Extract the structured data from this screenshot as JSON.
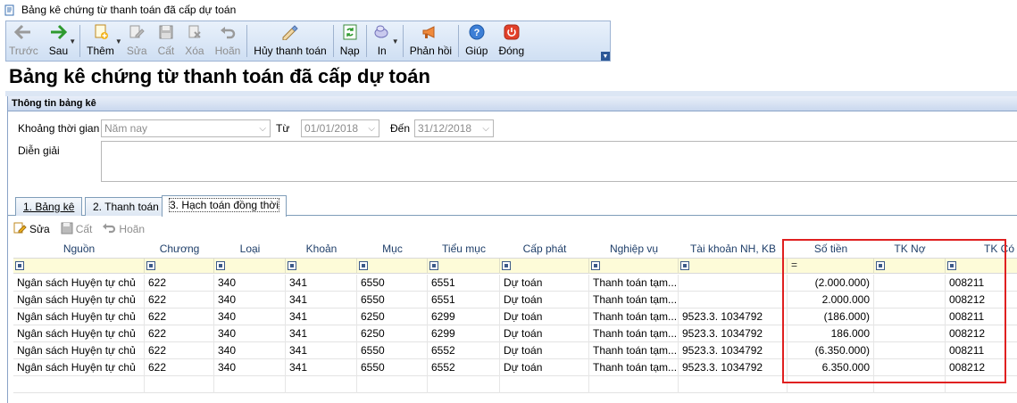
{
  "window": {
    "title": "Bảng kê chứng từ thanh toán đã cấp dự toán"
  },
  "toolbar": {
    "buttons": [
      {
        "label": "Trước",
        "icon": "arrow-left-icon",
        "enabled": false
      },
      {
        "label": "Sau",
        "icon": "arrow-right-icon",
        "enabled": true
      },
      {
        "label": "Thêm",
        "icon": "add-document-icon",
        "enabled": true
      },
      {
        "label": "Sửa",
        "icon": "edit-icon",
        "enabled": false
      },
      {
        "label": "Cất",
        "icon": "save-icon",
        "enabled": false
      },
      {
        "label": "Xóa",
        "icon": "delete-icon",
        "enabled": false
      },
      {
        "label": "Hoãn",
        "icon": "undo-icon",
        "enabled": false
      },
      {
        "label": "Hủy thanh toán",
        "icon": "cancel-payment-icon",
        "enabled": true
      },
      {
        "label": "Nạp",
        "icon": "refresh-icon",
        "enabled": true
      },
      {
        "label": "In",
        "icon": "print-icon",
        "enabled": true
      },
      {
        "label": "Phản hồi",
        "icon": "feedback-icon",
        "enabled": true
      },
      {
        "label": "Giúp",
        "icon": "help-icon",
        "enabled": true
      },
      {
        "label": "Đóng",
        "icon": "power-icon",
        "enabled": true
      }
    ]
  },
  "page": {
    "title": "Bảng kê chứng từ thanh toán đã cấp dự toán"
  },
  "info": {
    "header": "Thông tin bảng kê",
    "period_label": "Khoảng thời gian",
    "period_value": "Năm nay",
    "from_label": "Từ",
    "from_value": "01/01/2018",
    "to_label": "Đến",
    "to_value": "31/12/2018",
    "desc_label": "Diễn giải",
    "desc_value": ""
  },
  "tabs": [
    {
      "label": "1. Bảng kê"
    },
    {
      "label": "2. Thanh toán"
    },
    {
      "label": "3. Hạch toán đồng thời"
    }
  ],
  "subtoolbar": {
    "edit": "Sửa",
    "save": "Cất",
    "undo": "Hoãn"
  },
  "grid": {
    "columns": [
      "Nguồn",
      "Chương",
      "Loại",
      "Khoản",
      "Mục",
      "Tiểu mục",
      "Cấp phát",
      "Nghiệp vụ",
      "Tài khoản NH, KB",
      "Số tiền",
      "TK Nợ",
      "TK Có"
    ],
    "rows": [
      [
        "Ngân sách Huyện tự chủ",
        "622",
        "340",
        "341",
        "6550",
        "6551",
        "Dự toán",
        "Thanh toán tạm...",
        "",
        "(2.000.000)",
        "",
        "008211"
      ],
      [
        "Ngân sách Huyện tự chủ",
        "622",
        "340",
        "341",
        "6550",
        "6551",
        "Dự toán",
        "Thanh toán tạm...",
        "",
        "2.000.000",
        "",
        "008212"
      ],
      [
        "Ngân sách Huyện tự chủ",
        "622",
        "340",
        "341",
        "6250",
        "6299",
        "Dự toán",
        "Thanh toán tạm...",
        "9523.3. 1034792",
        "(186.000)",
        "",
        "008211"
      ],
      [
        "Ngân sách Huyện tự chủ",
        "622",
        "340",
        "341",
        "6250",
        "6299",
        "Dự toán",
        "Thanh toán tạm...",
        "9523.3. 1034792",
        "186.000",
        "",
        "008212"
      ],
      [
        "Ngân sách Huyện tự chủ",
        "622",
        "340",
        "341",
        "6550",
        "6552",
        "Dự toán",
        "Thanh toán tạm...",
        "9523.3. 1034792",
        "(6.350.000)",
        "",
        "008211"
      ],
      [
        "Ngân sách Huyện tự chủ",
        "622",
        "340",
        "341",
        "6550",
        "6552",
        "Dự toán",
        "Thanh toán tạm...",
        "9523.3. 1034792",
        "6.350.000",
        "",
        "008212"
      ]
    ]
  }
}
